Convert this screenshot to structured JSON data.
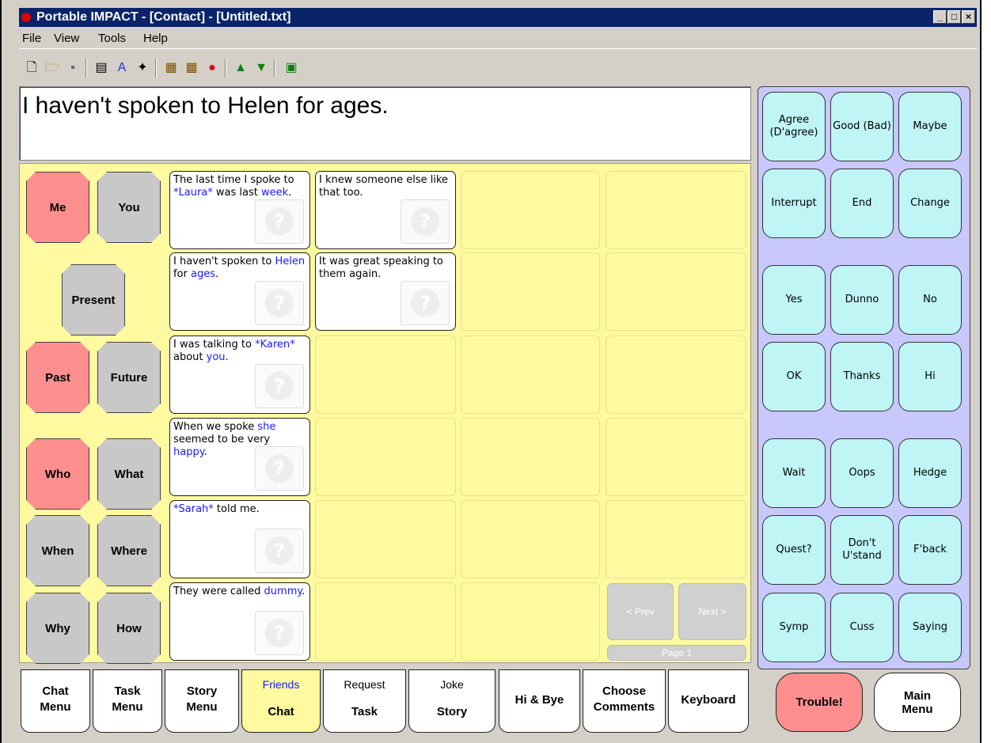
{
  "window": {
    "title": "Portable IMPACT - [Contact] - [Untitled.txt]"
  },
  "menu": [
    "File",
    "View",
    "Tools",
    "Help"
  ],
  "message": "I haven't spoken to Helen for ages.",
  "left_buttons": {
    "me": "Me",
    "you": "You",
    "present": "Present",
    "past": "Past",
    "future": "Future",
    "who": "Who",
    "what": "What",
    "when": "When",
    "where": "Where",
    "why": "Why",
    "how": "How"
  },
  "phrases": [
    {
      "parts": [
        "The last time I spoke to ",
        "*Laura*",
        " was last ",
        "week",
        "."
      ],
      "blue": [
        false,
        true,
        false,
        true,
        false
      ]
    },
    {
      "parts": [
        "I knew someone else like that too."
      ],
      "blue": [
        false
      ]
    },
    {
      "parts": [
        "I haven't spoken to ",
        "Helen",
        " for ",
        "ages",
        "."
      ],
      "blue": [
        false,
        true,
        false,
        true,
        false
      ]
    },
    {
      "parts": [
        "It was great speaking to them again."
      ],
      "blue": [
        false
      ]
    },
    {
      "parts": [
        "I was talking to ",
        "*Karen*",
        " about ",
        "you",
        "."
      ],
      "blue": [
        false,
        true,
        false,
        true,
        false
      ]
    },
    {
      "parts": [
        "When we spoke ",
        "she",
        " seemed to be very ",
        "happy",
        "."
      ],
      "blue": [
        false,
        true,
        false,
        true,
        false
      ]
    },
    {
      "parts": [
        "*Sarah*",
        " told me."
      ],
      "blue": [
        true,
        false
      ]
    },
    {
      "parts": [
        "They were called ",
        "dummy",
        "."
      ],
      "blue": [
        false,
        true,
        false
      ]
    }
  ],
  "qmark": "?",
  "nav": {
    "prev": "< Prev",
    "next": "Next >",
    "page": "Page 1"
  },
  "comments": [
    {
      "label": "Agree (D'agree)"
    },
    {
      "label": "Good (Bad)"
    },
    {
      "label": "Maybe"
    },
    {
      "label": "Interrupt"
    },
    {
      "label": "End"
    },
    {
      "label": "Change"
    },
    {
      "label": "Yes"
    },
    {
      "label": "Dunno"
    },
    {
      "label": "No"
    },
    {
      "label": "OK"
    },
    {
      "label": "Thanks"
    },
    {
      "label": "Hi"
    },
    {
      "label": "Wait"
    },
    {
      "label": "Oops"
    },
    {
      "label": "Hedge"
    },
    {
      "label": "Quest?"
    },
    {
      "label": "Don't U'stand"
    },
    {
      "label": "F'back"
    },
    {
      "label": "Symp"
    },
    {
      "label": "Cuss"
    },
    {
      "label": "Saying"
    }
  ],
  "tabs": [
    {
      "l1": "Chat",
      "l2": "Menu"
    },
    {
      "l1": "Task",
      "l2": "Menu"
    },
    {
      "l1": "Story",
      "l2": "Menu"
    },
    {
      "l1": "Friends",
      "l2": "Chat"
    },
    {
      "l1": "Request",
      "l2": "Task"
    },
    {
      "l1": "Joke",
      "l2": "Story"
    },
    {
      "l1": "Hi & Bye",
      "l2": ""
    },
    {
      "l1": "Choose",
      "l2": "Comments"
    },
    {
      "l1": "Keyboard",
      "l2": ""
    }
  ],
  "trouble": "Trouble!",
  "main_menu": {
    "l1": "Main",
    "l2": "Menu"
  },
  "colors": {
    "title_bar": "#0a246a",
    "grid_bg": "#fffaa0",
    "red_btn": "#ff8f8f",
    "gray_btn": "#c8c8c8",
    "cyan_btn": "#bff5f5",
    "side_panel": "#c8c8ff"
  }
}
